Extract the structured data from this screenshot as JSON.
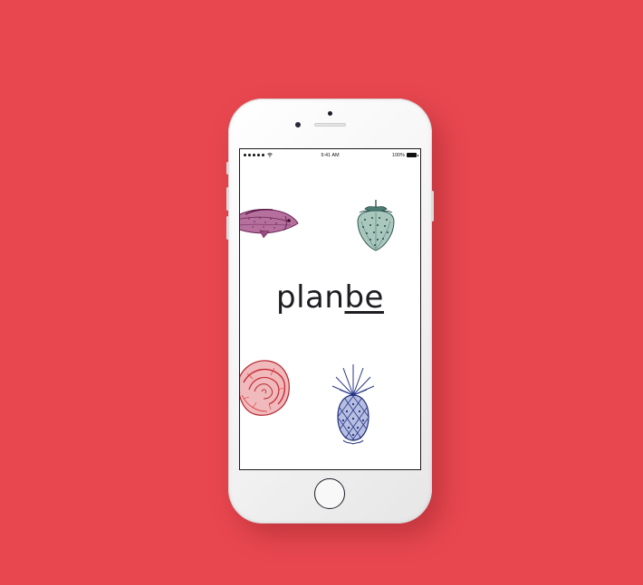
{
  "background_color": "#e8474f",
  "status_bar": {
    "time": "9:41 AM",
    "battery": "100%",
    "signal_icon": "signal-dots-icon",
    "wifi_icon": "wifi-icon",
    "battery_icon": "battery-icon"
  },
  "app": {
    "logo_part1": "plan",
    "logo_part2": "be"
  },
  "illustrations": [
    {
      "name": "fish-illustration",
      "color": "#8a3a6e"
    },
    {
      "name": "strawberry-illustration",
      "color": "#3f6b63"
    },
    {
      "name": "cabbage-illustration",
      "color": "#d6363e"
    },
    {
      "name": "pineapple-illustration",
      "color": "#27358a"
    }
  ],
  "device": {
    "home_button_icon": "home-button-icon"
  }
}
